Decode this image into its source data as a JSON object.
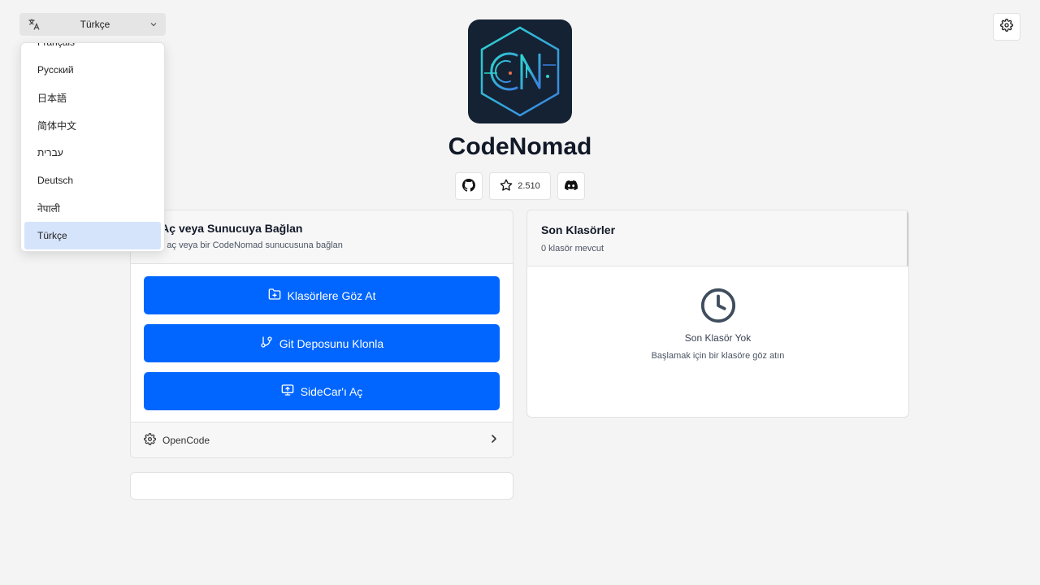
{
  "language": {
    "selected": "Türkçe",
    "options": [
      "Français",
      "Русский",
      "日本語",
      "简体中文",
      "עברית",
      "Deutsch",
      "नेपाली",
      "Türkçe"
    ]
  },
  "app": {
    "title": "CodeNomad",
    "logo_text": "CN"
  },
  "social": {
    "stars": "2.510"
  },
  "open_panel": {
    "title": "sör Aç veya Sunucuya Bağlan",
    "subtitle": "klasör aç veya bir CodeNomad sunucusuna bağlan",
    "buttons": {
      "browse": "Klasörlere Göz At",
      "clone": "Git Deposunu Klonla",
      "sidecar": "SideCar'ı Aç"
    },
    "footer_label": "OpenCode"
  },
  "recent_panel": {
    "title": "Son Klasörler",
    "count": "0 klasör mevcut",
    "empty_title": "Son Klasör Yok",
    "empty_subtitle": "Başlamak için bir klasöre göz atın"
  },
  "colors": {
    "accent": "#0066ff",
    "logo_bg": "#152233",
    "selected_option": "#d6e4fb"
  },
  "icons": [
    "translate-icon",
    "chevron-down-icon",
    "gear-icon",
    "github-icon",
    "star-icon",
    "discord-icon",
    "folder-plus-icon",
    "git-branch-icon",
    "monitor-upload-icon",
    "chevron-right-icon",
    "clock-icon"
  ]
}
